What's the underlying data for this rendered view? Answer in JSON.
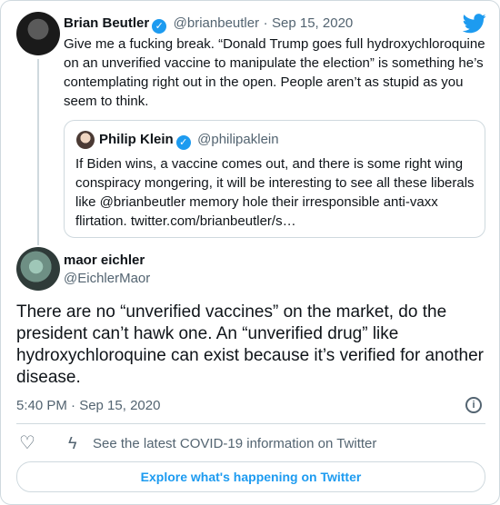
{
  "tweet": {
    "author_name": "Brian Beutler",
    "author_handle": "@brianbeutler",
    "separator": "·",
    "date": "Sep 15, 2020",
    "text": "Give me a fucking break. “Donald Trump goes full hydroxychloroquine on an unverified vaccine to manipulate the election” is something he’s contemplating right out in the open. People aren’t as stupid as you seem to think."
  },
  "quoted_tweet": {
    "author_name": "Philip Klein",
    "author_handle": "@philipaklein",
    "text": "If Biden wins, a vaccine comes out, and there is some right wing conspiracy mongering,  it will be interesting to see all these liberals like @brianbeutler memory hole their irresponsible anti-vaxx flirtation. twitter.com/brianbeutler/s…"
  },
  "reply": {
    "author_name": "maor eichler",
    "author_handle": "@EichlerMaor",
    "text": "There are no “unverified vaccines” on the market, do the president can’t hawk one. An “unverified drug” like hydroxychloroquine can exist because it’s verified for another disease.",
    "timestamp": "5:40 PM · Sep 15, 2020"
  },
  "footer": {
    "covid_info": "See the latest COVID-19 information on Twitter",
    "explore_label": "Explore what's happening on Twitter"
  },
  "icons": {
    "verified": "verified-badge-icon",
    "brand": "twitter-bird-icon",
    "info": "info-icon",
    "like": "heart-icon",
    "covid": "lightning-bolt-icon"
  },
  "colors": {
    "accent": "#1d9bf0",
    "text": "#0f1419",
    "muted": "#536471",
    "border": "#cfd9de"
  }
}
